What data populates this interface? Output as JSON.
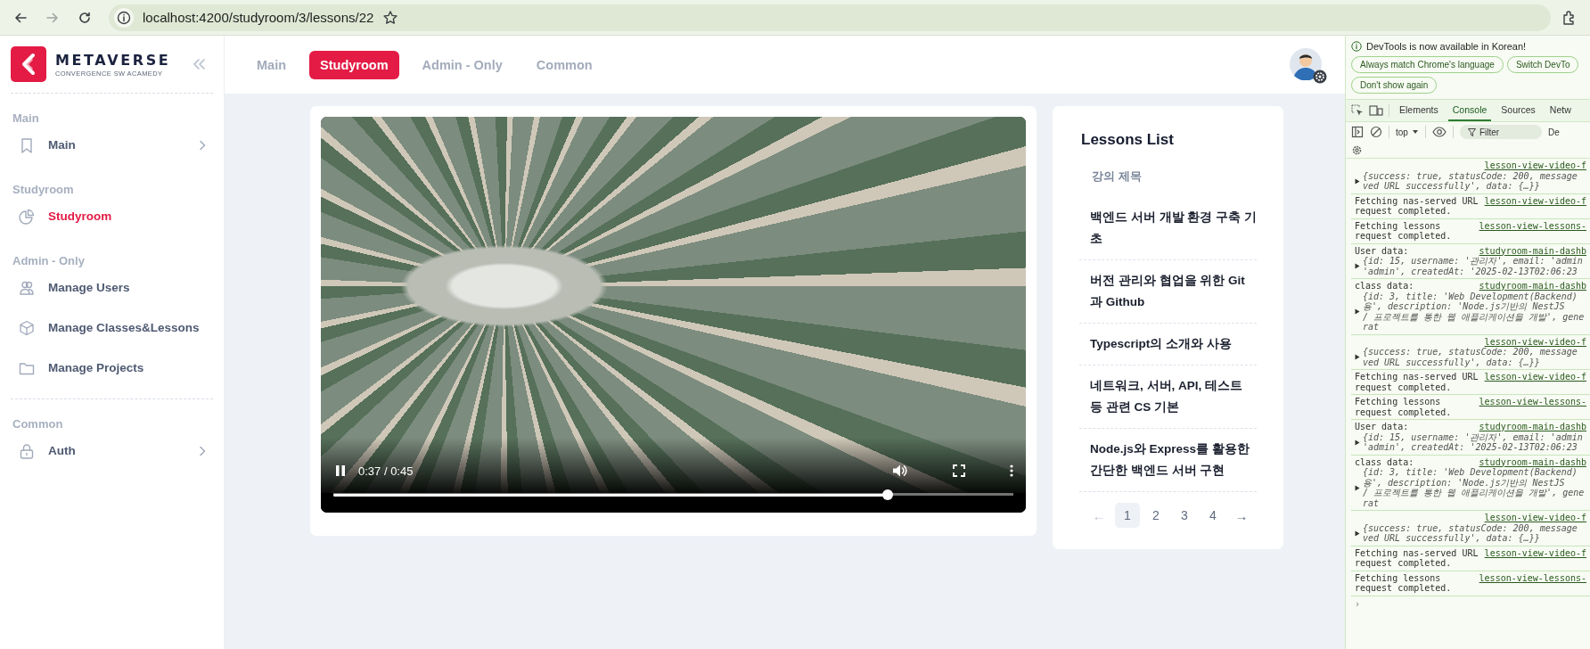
{
  "browser": {
    "nav": [
      {
        "kind": "back",
        "disabled": false
      },
      {
        "kind": "forward",
        "disabled": true
      },
      {
        "kind": "reload",
        "disabled": false
      }
    ],
    "url": "localhost:4200/studyroom/3/lessons/22"
  },
  "sidebar": {
    "logo": {
      "name": "METAVERSE",
      "tagline": "CONVERGENCE SW ACAMEDY"
    },
    "sections": [
      {
        "heading": "Main",
        "items": [
          {
            "label": "Main",
            "selected": false,
            "expandable": true
          }
        ]
      },
      {
        "heading": "Studyroom",
        "items": [
          {
            "label": "Studyroom",
            "selected": true,
            "expandable": false
          }
        ]
      },
      {
        "heading": "Admin - Only",
        "items": [
          {
            "label": "Manage Users",
            "selected": false,
            "expandable": false
          },
          {
            "label": "Manage Classes&Lessons",
            "selected": false,
            "expandable": false
          },
          {
            "label": "Manage Projects",
            "selected": false,
            "expandable": false
          }
        ]
      },
      {
        "heading": "Common",
        "items": [
          {
            "label": "Auth",
            "selected": false,
            "expandable": true
          }
        ]
      }
    ]
  },
  "topnav": {
    "tabs": [
      {
        "label": "Main",
        "selected": false
      },
      {
        "label": "Studyroom",
        "selected": true
      },
      {
        "label": "Admin - Only",
        "selected": false
      },
      {
        "label": "Common",
        "selected": false
      }
    ]
  },
  "video": {
    "time": "0:37 / 0:45",
    "level": 0.82,
    "playing": true
  },
  "lessons": {
    "title": "Lessons List",
    "column_header": "강의 제목",
    "items": [
      "백엔드 서버 개발 환경 구축 기초",
      "버전 관리와 협업을 위한 Git과 Github",
      "Typescript의 소개와 사용",
      "네트워크, 서버, API, 테스트 등 관련 CS 기본",
      "Node.js와 Express를 활용한 간단한 백엔드 서버 구현"
    ],
    "pagination": {
      "prev": {
        "label": "←",
        "disabled": true
      },
      "pages": [
        {
          "label": "1",
          "selected": true
        },
        {
          "label": "2",
          "selected": false
        },
        {
          "label": "3",
          "selected": false
        },
        {
          "label": "4",
          "selected": false
        }
      ],
      "next": {
        "label": "→",
        "disabled": false
      }
    }
  },
  "devtools": {
    "notice": "DevTools is now available in Korean!",
    "notice_buttons": [
      "Always match Chrome's language",
      "Switch DevTo",
      "Don't show again"
    ],
    "tabs": [
      {
        "label": "Elements",
        "selected": false
      },
      {
        "label": "Console",
        "selected": true
      },
      {
        "label": "Sources",
        "selected": false
      },
      {
        "label": "Netw",
        "selected": false
      }
    ],
    "context": "top",
    "filter": {
      "placeholder": "Filter"
    },
    "levels": "De",
    "messages": [
      {
        "kind": "object",
        "source": "lesson-view-video-f",
        "lines": [
          "{success: true, statusCode: 200, message",
          "ved URL successfully', data: {…}}"
        ]
      },
      {
        "kind": "log",
        "source": "lesson-view-video-f",
        "text": "Fetching nas-served URL request completed."
      },
      {
        "kind": "log",
        "source": "lesson-view-lessons-",
        "text": "Fetching lessons request completed."
      },
      {
        "kind": "labelled",
        "label": "User data:",
        "source": "studyroom-main-dashb",
        "lines": [
          "{id: 15, username: '관리자', email: 'admin",
          "'admin', createdAt: '2025-02-13T02:06:23"
        ]
      },
      {
        "kind": "labelled",
        "label": "class data:",
        "source": "studyroom-main-dashb",
        "lines": [
          "{id: 3, title: 'Web Development(Backend)",
          "용', description: 'Node.js기반의 NestJS",
          "/ 프로젝트를 통한 웹 애플리케이션을 개발', generat"
        ]
      },
      {
        "kind": "object",
        "source": "lesson-view-video-f",
        "lines": [
          "{success: true, statusCode: 200, message",
          "ved URL successfully', data: {…}}"
        ]
      },
      {
        "kind": "log",
        "source": "lesson-view-video-f",
        "text": "Fetching nas-served URL request completed."
      },
      {
        "kind": "log",
        "source": "lesson-view-lessons-",
        "text": "Fetching lessons request completed."
      },
      {
        "kind": "labelled",
        "label": "User data:",
        "source": "studyroom-main-dashb",
        "lines": [
          "{id: 15, username: '관리자', email: 'admin",
          "'admin', createdAt: '2025-02-13T02:06:23"
        ]
      },
      {
        "kind": "labelled",
        "label": "class data:",
        "source": "studyroom-main-dashb",
        "lines": [
          "{id: 3, title: 'Web Development(Backend)",
          "용', description: 'Node.js기반의 NestJS",
          "/ 프로젝트를 통한 웹 애플리케이션을 개발', generat"
        ]
      },
      {
        "kind": "object",
        "source": "lesson-view-video-f",
        "lines": [
          "{success: true, statusCode: 200, message",
          "ved URL successfully', data: {…}}"
        ]
      },
      {
        "kind": "log",
        "source": "lesson-view-video-f",
        "text": "Fetching nas-served URL request completed."
      },
      {
        "kind": "log",
        "source": "lesson-view-lessons-",
        "text": "Fetching lessons request completed."
      }
    ],
    "prompt": "›"
  }
}
